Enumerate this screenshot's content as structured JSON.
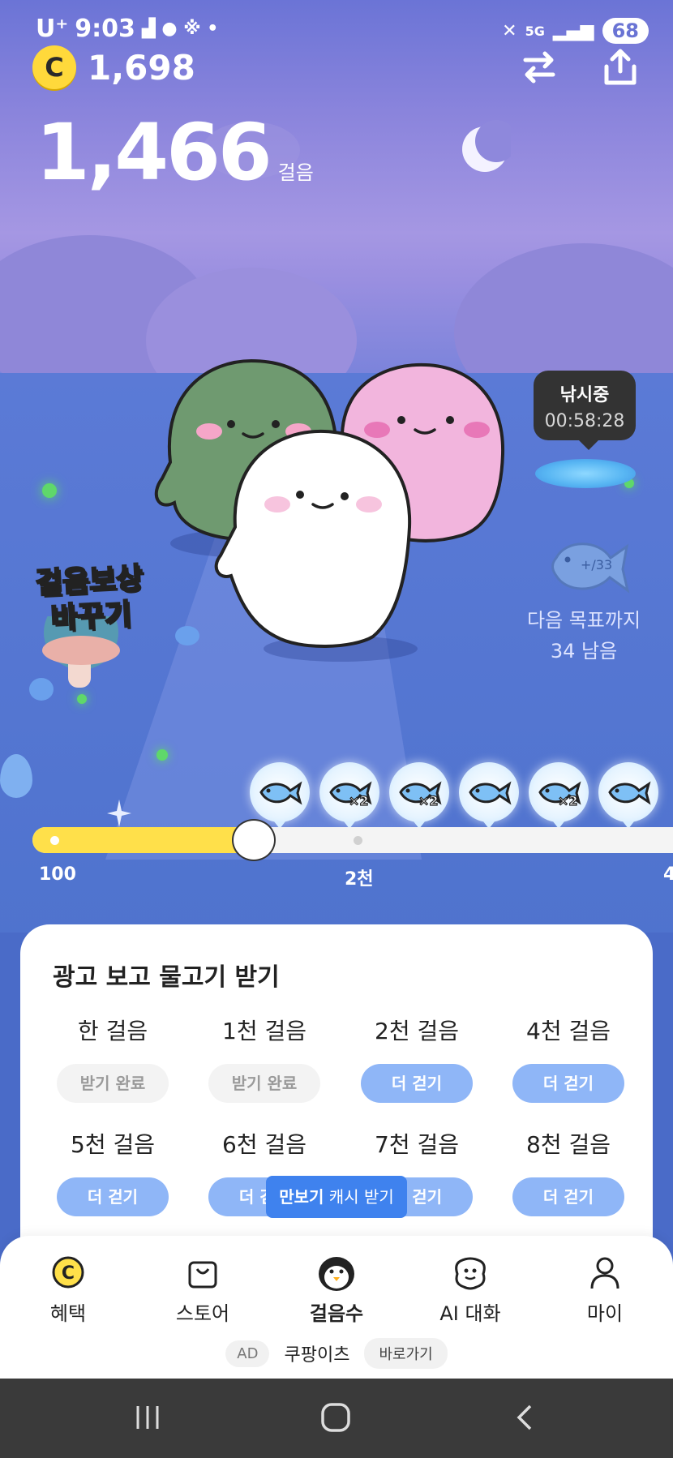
{
  "status_bar": {
    "carrier": "U⁺",
    "time": "9:03",
    "battery": "68"
  },
  "header": {
    "coin_symbol": "C",
    "coin_balance": "1,698",
    "swap_icon": "swap-arrows-icon",
    "share_icon": "share-icon"
  },
  "steps": {
    "count": "1,466",
    "unit": "걸음"
  },
  "fishing": {
    "label": "낚시중",
    "timer": "00:58:28"
  },
  "next_goal": {
    "line1": "다음 목표까지",
    "line2": "34 남음"
  },
  "reward_badge": {
    "line1": "걸음보상",
    "line2": "바꾸기"
  },
  "progress": {
    "fraction": 0.33,
    "ticks": [
      "100",
      "2천",
      "4"
    ],
    "fish_icons": [
      {
        "multiplier": ""
      },
      {
        "multiplier": "×2"
      },
      {
        "multiplier": "×2"
      },
      {
        "multiplier": ""
      },
      {
        "multiplier": "×2"
      },
      {
        "multiplier": ""
      }
    ]
  },
  "ad_card": {
    "title": "광고 보고 물고기 받기",
    "items": [
      {
        "label": "한 걸음",
        "button": "받기 완료",
        "state": "done"
      },
      {
        "label": "1천 걸음",
        "button": "받기 완료",
        "state": "done"
      },
      {
        "label": "2천 걸음",
        "button": "더 걷기",
        "state": "walk"
      },
      {
        "label": "4천 걸음",
        "button": "더 걷기",
        "state": "walk"
      },
      {
        "label": "5천 걸음",
        "button": "더 걷기",
        "state": "walk"
      },
      {
        "label": "6천 걸음",
        "button": "더 걷기",
        "state": "walk"
      },
      {
        "label": "7천 걸음",
        "button": "더 걷기",
        "state": "walk"
      },
      {
        "label": "8천 걸음",
        "button": "더 걷기",
        "state": "walk"
      }
    ],
    "tooltip_bold": "만보기",
    "tooltip_rest": " 캐시 받기"
  },
  "bottom_nav": {
    "items": [
      {
        "label": "혜택",
        "icon": "coin-c-icon"
      },
      {
        "label": "스토어",
        "icon": "shopping-bag-icon"
      },
      {
        "label": "걸음수",
        "icon": "penguin-icon",
        "active": true
      },
      {
        "label": "AI 대화",
        "icon": "chat-face-icon"
      },
      {
        "label": "마이",
        "icon": "person-icon"
      }
    ],
    "ad_tag": "AD",
    "ad_name": "쿠팡이츠",
    "ad_go": "바로가기"
  },
  "colors": {
    "accent_blue": "#3f82ee",
    "button_blue": "#8fb6f7",
    "progress_yellow": "#ffe04a",
    "coin_yellow": "#ffd93b"
  }
}
